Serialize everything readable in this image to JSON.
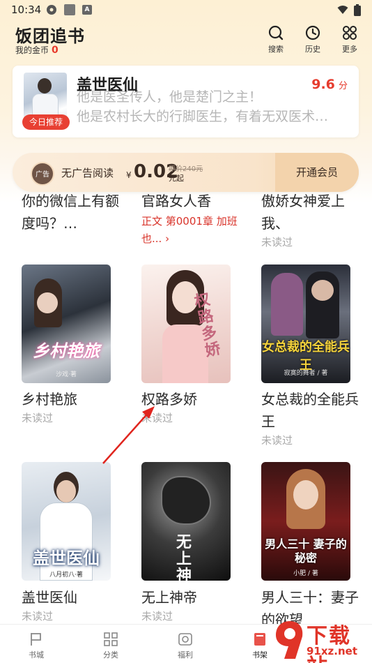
{
  "status_bar": {
    "time": "10:34",
    "a_badge": "A"
  },
  "header": {
    "title": "饭团追书",
    "coins_label": "我的金币",
    "coins_value": "0",
    "buttons": {
      "search": "搜索",
      "history": "历史",
      "more": "更多"
    }
  },
  "recommend": {
    "badge": "今日推荐",
    "title": "盖世医仙",
    "score": "9.6",
    "score_unit": "分",
    "line1": "他是医圣传人，他是楚门之主！",
    "line2": "他是农村长大的行脚医生，有着无双医术…"
  },
  "vip": {
    "logo_text": "广告",
    "no_ad": "无广告阅读",
    "currency": "¥",
    "price": "0.02",
    "original_price": "原价240元",
    "unit": "元起",
    "button": "开通会员"
  },
  "books_row0": [
    {
      "title": "你的微信上有额度吗？…",
      "status": "",
      "chapter": ""
    },
    {
      "title": "官路女人香",
      "status": "",
      "chapter": "正文 第0001章 加班也... ›"
    },
    {
      "title": "傲娇女神爱上我、",
      "status": "未读过",
      "chapter": ""
    }
  ],
  "books_row1": [
    {
      "title": "乡村艳旅",
      "status": "未读过",
      "cover_text": "乡村艳旅",
      "cover_author": "沙戏·著"
    },
    {
      "title": "权路多娇",
      "status": "未读过",
      "cover_text": "权路多娇"
    },
    {
      "title": "女总裁的全能兵王",
      "status": "未读过",
      "cover_text": "女总裁的全能兵王",
      "cover_author": "寂寞的舞者 / 著"
    }
  ],
  "books_row2": [
    {
      "title": "盖世医仙",
      "status": "未读过",
      "cover_text": "盖世医仙",
      "cover_author": "八月初八·著"
    },
    {
      "title": "无上神帝",
      "status": "未读过",
      "cover_text": "无上神帝"
    },
    {
      "title": "男人三十：妻子的欲望",
      "status": "",
      "cover_text": "男人三十 妻子的秘密",
      "cover_author": "小肥 / 著"
    }
  ],
  "bottom_nav": [
    {
      "label": "书城"
    },
    {
      "label": "分类"
    },
    {
      "label": "福利"
    },
    {
      "label": "书架"
    }
  ],
  "watermark": {
    "text": "下载站",
    "url": "91xz.net"
  },
  "colors": {
    "accent_red": "#e63c2e",
    "header_bg": "#fdf0d4",
    "vip_brown": "#3a2b22"
  }
}
